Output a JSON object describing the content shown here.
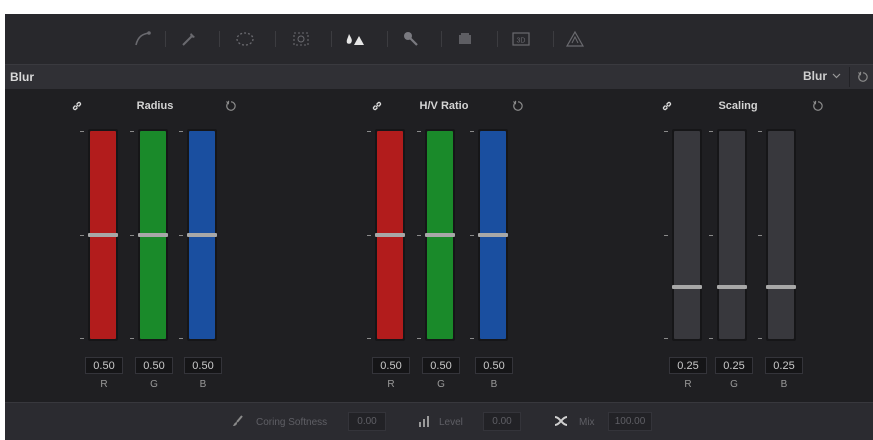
{
  "panel": {
    "title": "Blur",
    "mode": "Blur"
  },
  "groups": [
    {
      "title": "Radius",
      "channels": [
        {
          "label": "R",
          "value": "0.50",
          "level": 0.5,
          "color": "#b21c1c"
        },
        {
          "label": "G",
          "value": "0.50",
          "level": 0.5,
          "color": "#1a8a2a"
        },
        {
          "label": "B",
          "value": "0.50",
          "level": 0.5,
          "color": "#1a4fa0"
        }
      ]
    },
    {
      "title": "H/V Ratio",
      "channels": [
        {
          "label": "R",
          "value": "0.50",
          "level": 0.5,
          "color": "#b21c1c"
        },
        {
          "label": "G",
          "value": "0.50",
          "level": 0.5,
          "color": "#1a8a2a"
        },
        {
          "label": "B",
          "value": "0.50",
          "level": 0.5,
          "color": "#1a4fa0"
        }
      ]
    },
    {
      "title": "Scaling",
      "channels": [
        {
          "label": "R",
          "value": "0.25",
          "level": 0.25,
          "color": "#38383d"
        },
        {
          "label": "G",
          "value": "0.25",
          "level": 0.25,
          "color": "#38383d"
        },
        {
          "label": "B",
          "value": "0.25",
          "level": 0.25,
          "color": "#38383d"
        }
      ]
    }
  ],
  "footer": {
    "coring_label": "Coring Softness",
    "coring_value": "0.00",
    "level_label": "Level",
    "level_value": "0.00",
    "mix_label": "Mix",
    "mix_value": "100.00"
  },
  "toolbar_icons": [
    "curve-icon",
    "picker-icon",
    "window-icon",
    "tracker-icon",
    "blur-icon",
    "key-icon",
    "sizing-icon",
    "3d-icon",
    "fx-icon"
  ]
}
